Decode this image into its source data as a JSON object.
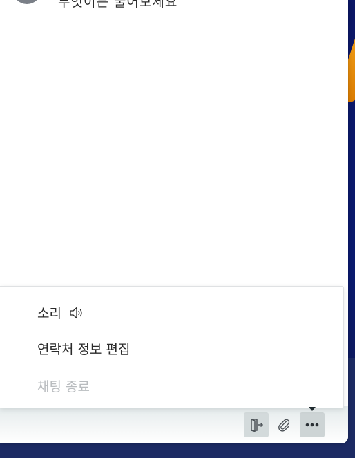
{
  "header": {
    "subtitle": "무엇이든 물어보세요"
  },
  "menu": {
    "items": [
      {
        "label": "소리",
        "icon": "speaker-icon",
        "enabled": true
      },
      {
        "label": "연락처 정보 편집",
        "enabled": true
      },
      {
        "label": "채팅 종료",
        "enabled": false
      }
    ]
  },
  "toolbar": {
    "buttons": [
      {
        "icon": "exit-icon"
      },
      {
        "icon": "paperclip-icon"
      },
      {
        "icon": "more-dots-icon"
      }
    ]
  },
  "colors": {
    "backdrop": "#0c1766",
    "accent": "#f3a21a",
    "disabled_text": "#b9bcbf",
    "text": "#2b2b2b"
  }
}
